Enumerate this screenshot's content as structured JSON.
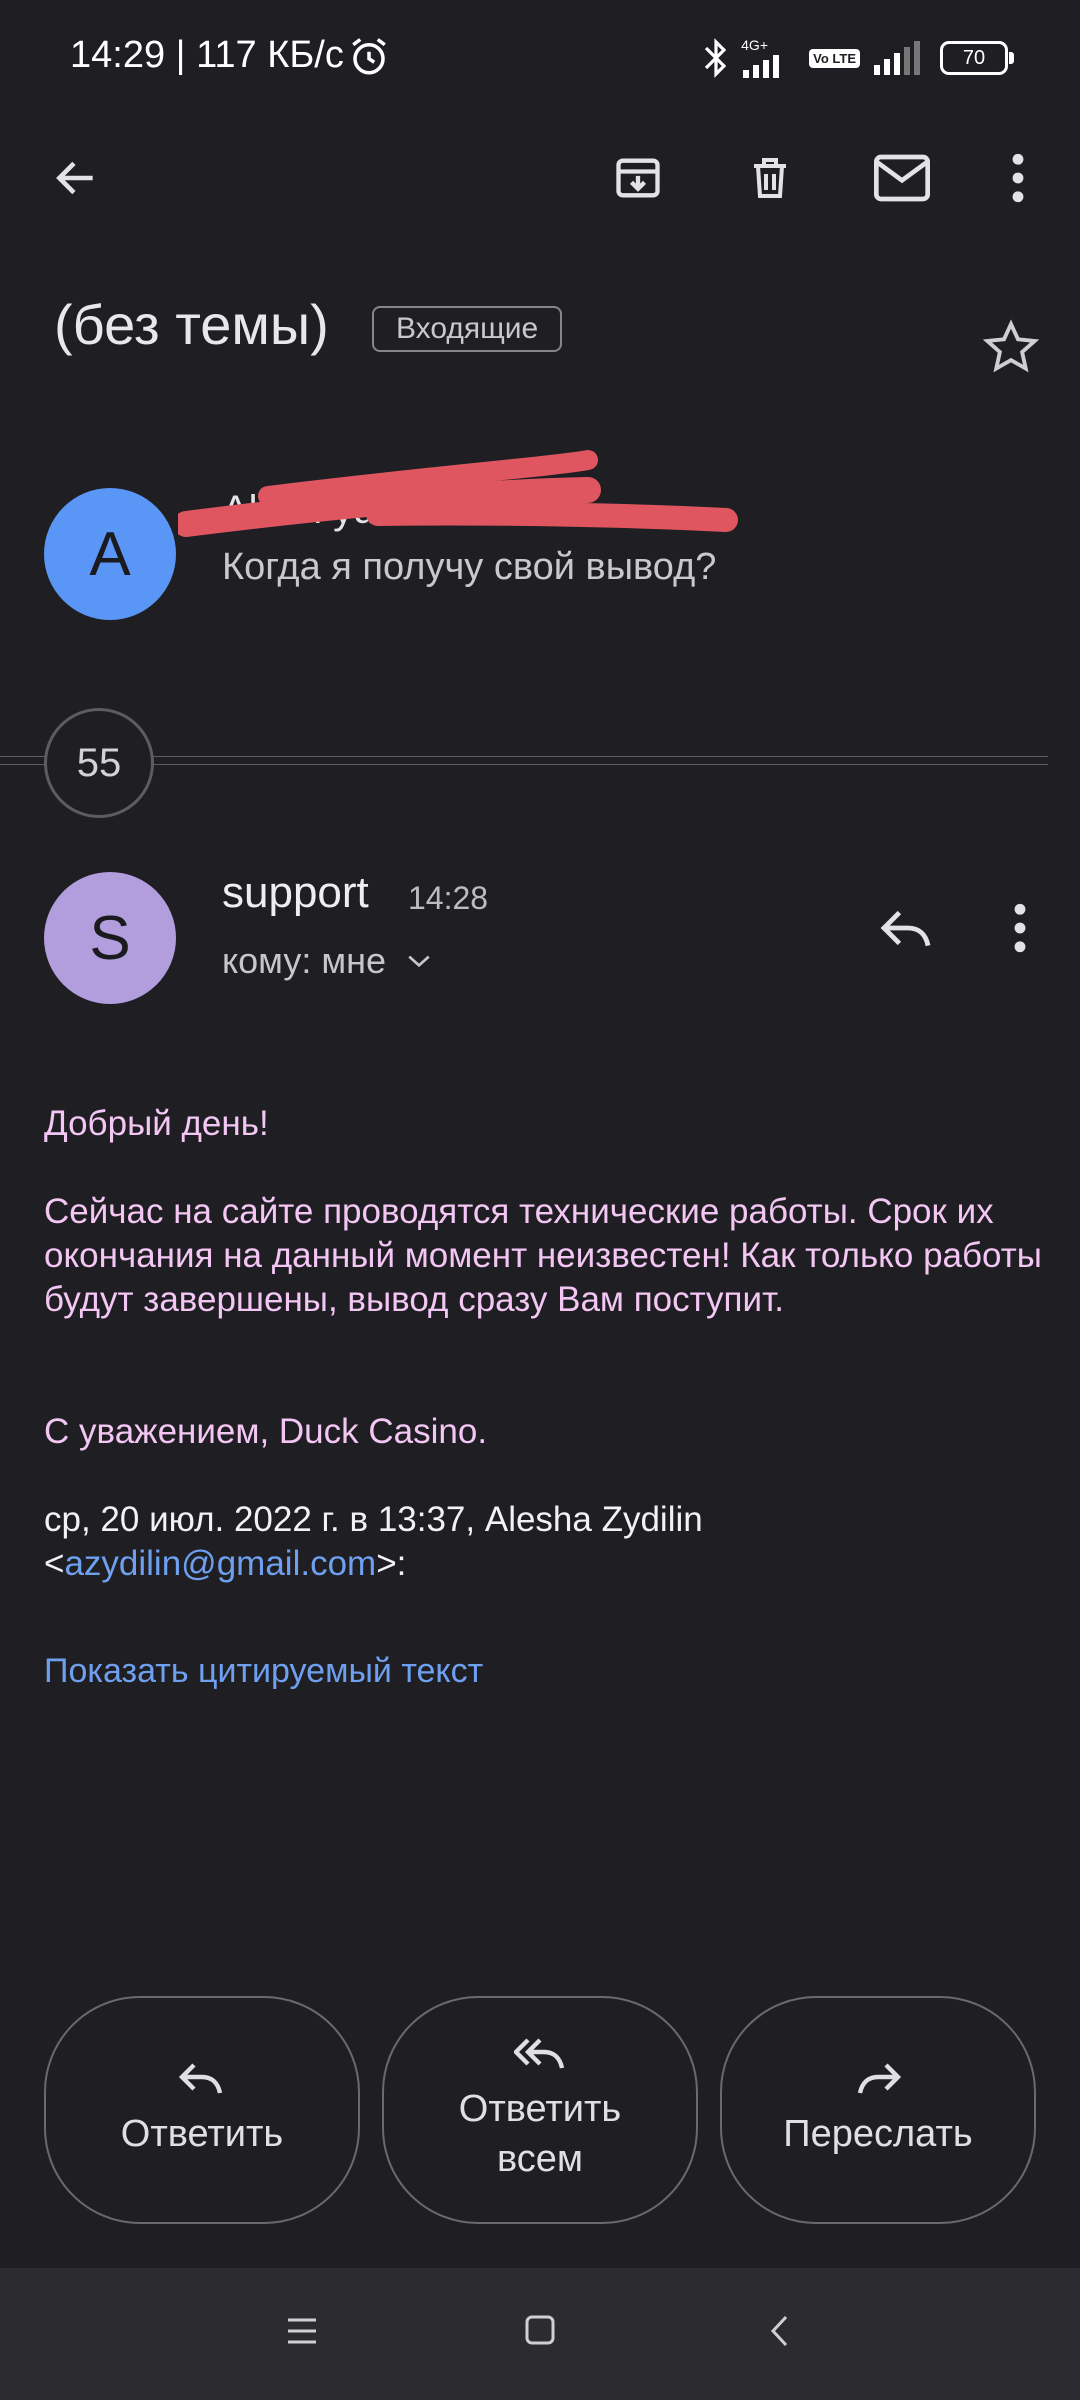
{
  "status_bar": {
    "time_speed": "14:29 | 117 КБ/с",
    "network_label": "4G+",
    "volte_label": "Vo LTE",
    "battery": "70"
  },
  "toolbar": {
    "icons": [
      "back-arrow-icon",
      "archive-icon",
      "delete-icon",
      "mark-unread-icon",
      "more-vert-icon"
    ]
  },
  "subject": {
    "title": "(без темы)",
    "label": "Входящие"
  },
  "first_message": {
    "avatar_letter": "A",
    "avatar_color": "#5a96f5",
    "sender_visible": "Alesh    ydilin",
    "snippet": "Когда я получу свой вывод?"
  },
  "collapsed": {
    "count": "55"
  },
  "message": {
    "avatar_letter": "S",
    "avatar_color": "#b29ddd",
    "sender": "support",
    "time": "14:28",
    "to": "кому: мне",
    "greeting": "Добрый день!",
    "paragraph": "Сейчас на сайте проводятся технические работы. Срок их окончания  на данный момент неизвестен! Как только работы будут завершены, вывод сразу Вам поступит.",
    "signature": "С уважением, Duck Casino.",
    "quote_header": "ср, 20 июл. 2022 г. в 13:37, Alesha Zydilin",
    "quote_email_open": "<",
    "quote_email": "azydilin@gmail.com",
    "quote_email_close": ">:",
    "show_quoted": "Показать цитируемый текст"
  },
  "actions": {
    "reply": "Ответить",
    "reply_all_line1": "Ответить",
    "reply_all_line2": "всем",
    "forward": "Переслать"
  },
  "colors": {
    "background": "#1f1e23",
    "body_text": "#f3c6f3",
    "link": "#6fa0f0",
    "redaction": "#e05660"
  }
}
